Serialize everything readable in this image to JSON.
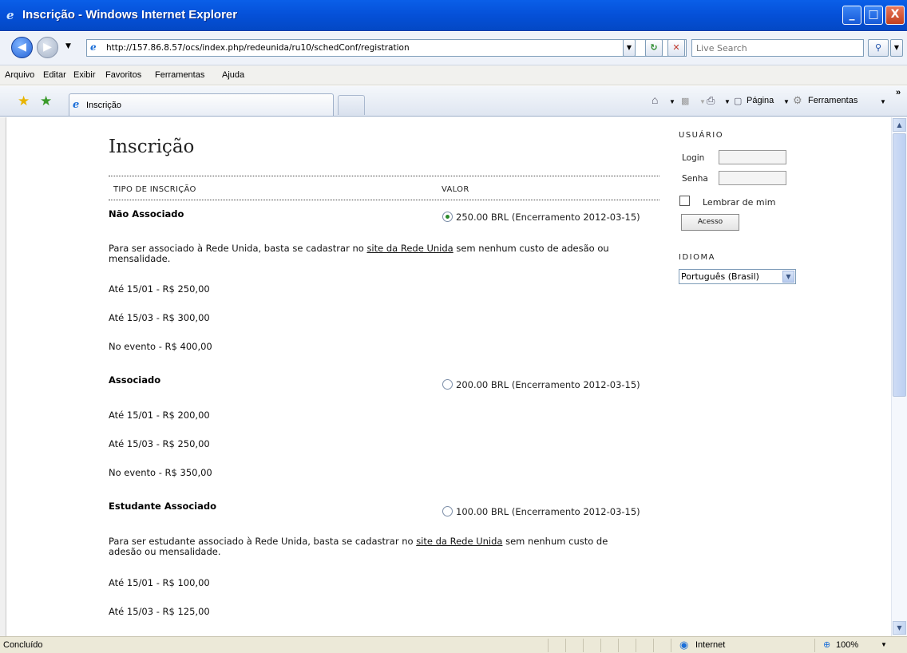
{
  "window": {
    "title": "Inscrição - Windows Internet Explorer",
    "minimize": "_",
    "maximize": "□",
    "close": "X"
  },
  "addressbar": {
    "url": "http://157.86.8.57/ocs/index.php/redeunida/ru10/schedConf/registration",
    "search_placeholder": "Live Search"
  },
  "menu": [
    "Arquivo",
    "Editar",
    "Exibir",
    "Favoritos",
    "Ferramentas",
    "Ajuda"
  ],
  "tabs": {
    "active_label": "Inscrição"
  },
  "commandbar": {
    "page_label": "Página",
    "tools_label": "Ferramentas",
    "more": "»"
  },
  "page": {
    "title": "Inscrição",
    "col_type": "TIPO DE INSCRIÇÃO",
    "col_value": "VALOR",
    "types": [
      {
        "name": "Não Associado",
        "price": "250.00 BRL (Encerramento 2012-03-15)",
        "checked": true,
        "desc_pre": "Para ser associado à Rede Unida, basta se cadastrar no ",
        "desc_link": "site da Rede Unida",
        "desc_post": " sem nenhum custo de adesão ou mensalidade.",
        "lines": [
          "Até 15/01 - R$ 250,00",
          "Até 15/03 - R$ 300,00",
          "No evento - R$ 400,00"
        ]
      },
      {
        "name": "Associado",
        "price": "200.00 BRL (Encerramento 2012-03-15)",
        "checked": false,
        "lines": [
          "Até 15/01 - R$ 200,00",
          "Até 15/03 - R$ 250,00",
          "No evento - R$ 350,00"
        ]
      },
      {
        "name": "Estudante Associado",
        "price": "100.00 BRL (Encerramento 2012-03-15)",
        "checked": false,
        "desc_pre": "Para ser estudante associado à Rede Unida, basta se cadastrar no ",
        "desc_link": "site da Rede Unida",
        "desc_post": " sem nenhum custo de adesão ou mensalidade.",
        "lines": [
          "Até 15/01 - R$ 100,00",
          "Até 15/03 - R$ 125,00"
        ]
      }
    ]
  },
  "sidebar": {
    "user_heading": "USUÁRIO",
    "login_label": "Login",
    "password_label": "Senha",
    "remember_label": "Lembrar de mim",
    "login_button": "Acesso",
    "language_heading": "IDIOMA",
    "language_value": "Português (Brasil)"
  },
  "statusbar": {
    "status": "Concluído",
    "zone": "Internet",
    "zoom": "100%"
  }
}
